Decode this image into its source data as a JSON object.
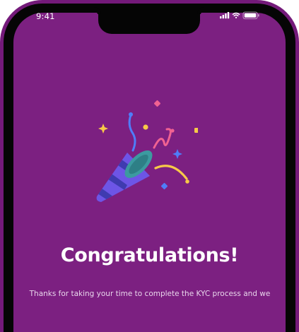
{
  "status_bar": {
    "time": "9:41",
    "icons": [
      "signal-icon",
      "wifi-icon",
      "battery-icon"
    ]
  },
  "hero": {
    "illustration": "party-popper-icon",
    "title": "Congratulations!",
    "message": "Thanks for taking your time to complete the KYC process and we"
  },
  "colors": {
    "frame": "#741a7a",
    "screen": "#7c2081",
    "bezel": "#050505",
    "title": "#ffffff",
    "body": "#e9d6ec"
  }
}
